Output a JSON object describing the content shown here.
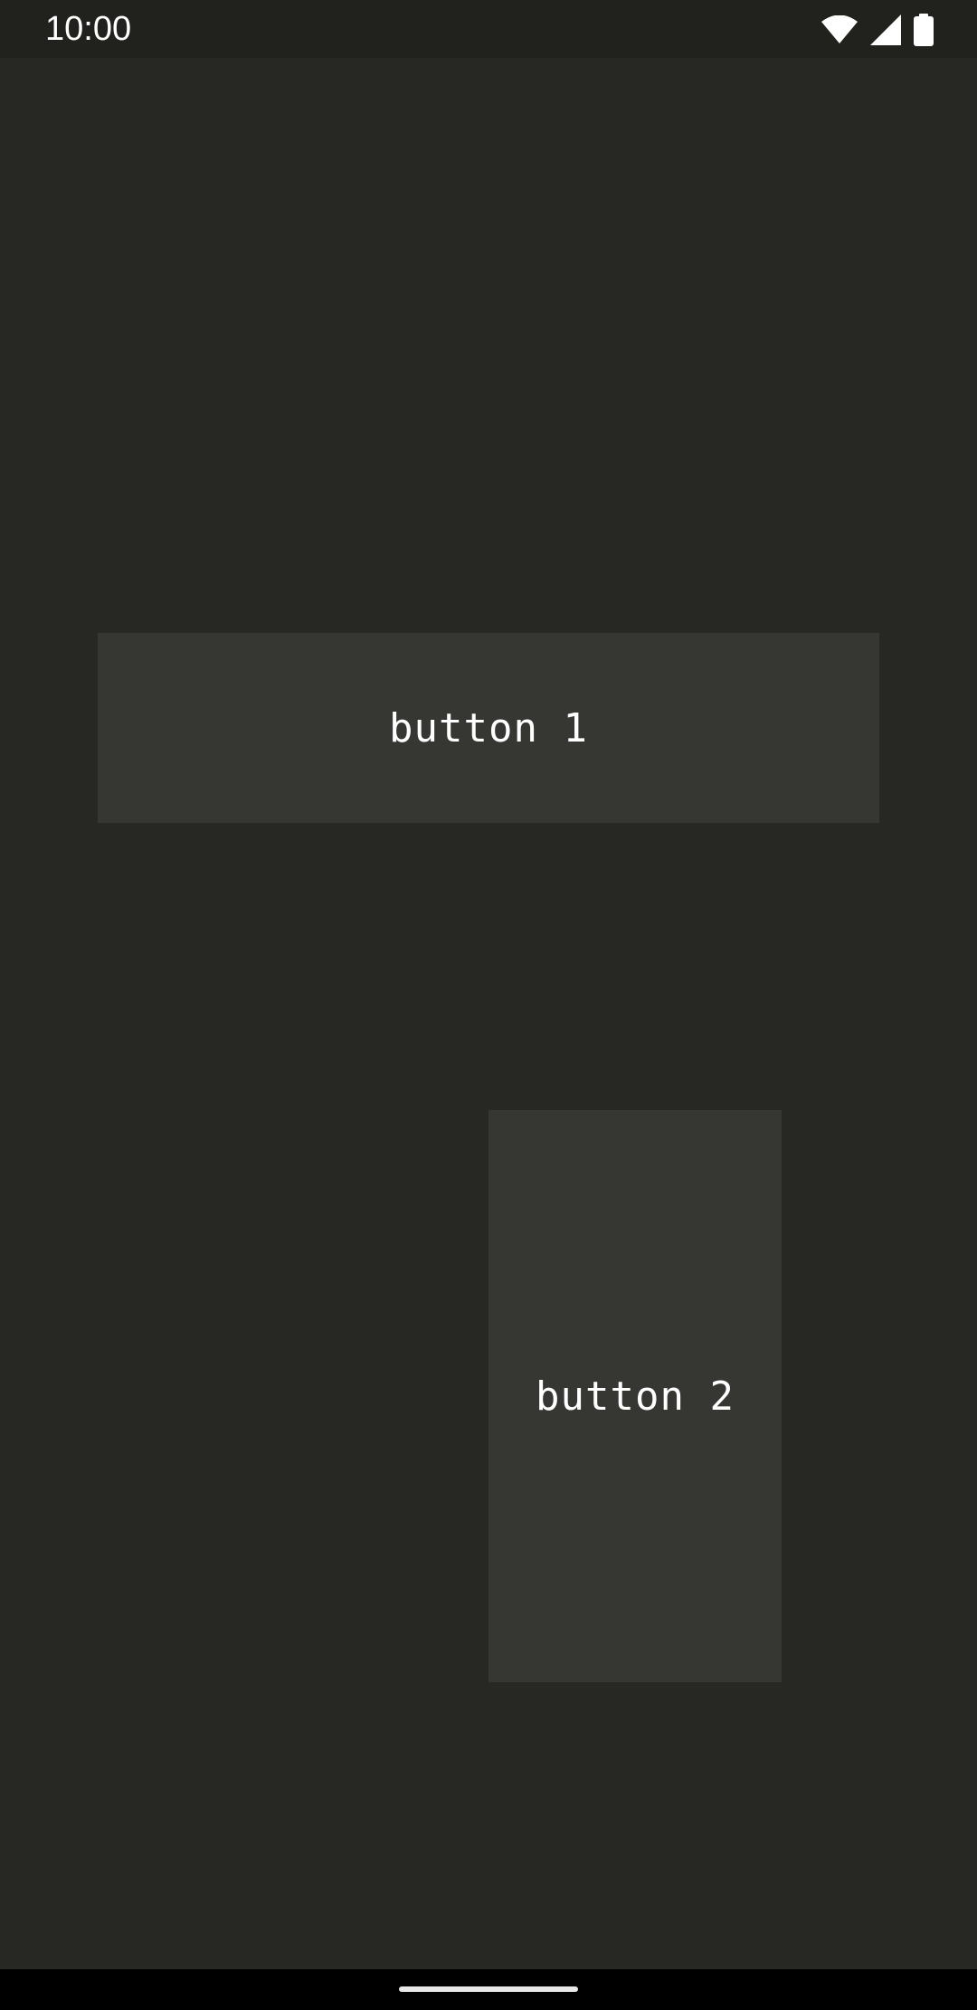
{
  "status_bar": {
    "time": "10:00",
    "icons": [
      "wifi-icon",
      "signal-icon",
      "battery-icon"
    ]
  },
  "main": {
    "button_1_label": "button 1",
    "button_2_label": "button 2"
  },
  "colors": {
    "background": "#272823",
    "button": "#363733",
    "status_bar": "#21221e",
    "nav_bar": "#000000",
    "text": "#ffffff"
  }
}
